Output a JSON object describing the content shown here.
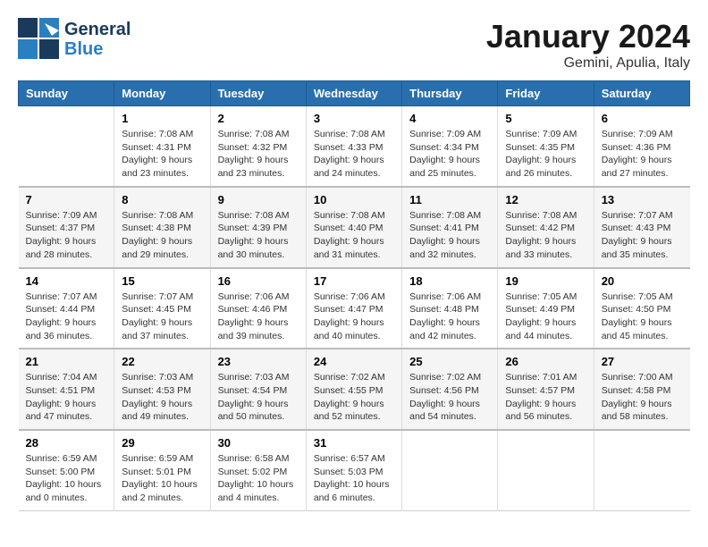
{
  "logo": {
    "line1": "General",
    "line2": "Blue"
  },
  "title": "January 2024",
  "location": "Gemini, Apulia, Italy",
  "headers": [
    "Sunday",
    "Monday",
    "Tuesday",
    "Wednesday",
    "Thursday",
    "Friday",
    "Saturday"
  ],
  "weeks": [
    [
      {
        "day": "",
        "info": ""
      },
      {
        "day": "1",
        "info": "Sunrise: 7:08 AM\nSunset: 4:31 PM\nDaylight: 9 hours\nand 23 minutes."
      },
      {
        "day": "2",
        "info": "Sunrise: 7:08 AM\nSunset: 4:32 PM\nDaylight: 9 hours\nand 23 minutes."
      },
      {
        "day": "3",
        "info": "Sunrise: 7:08 AM\nSunset: 4:33 PM\nDaylight: 9 hours\nand 24 minutes."
      },
      {
        "day": "4",
        "info": "Sunrise: 7:09 AM\nSunset: 4:34 PM\nDaylight: 9 hours\nand 25 minutes."
      },
      {
        "day": "5",
        "info": "Sunrise: 7:09 AM\nSunset: 4:35 PM\nDaylight: 9 hours\nand 26 minutes."
      },
      {
        "day": "6",
        "info": "Sunrise: 7:09 AM\nSunset: 4:36 PM\nDaylight: 9 hours\nand 27 minutes."
      }
    ],
    [
      {
        "day": "7",
        "info": "Sunrise: 7:09 AM\nSunset: 4:37 PM\nDaylight: 9 hours\nand 28 minutes."
      },
      {
        "day": "8",
        "info": "Sunrise: 7:08 AM\nSunset: 4:38 PM\nDaylight: 9 hours\nand 29 minutes."
      },
      {
        "day": "9",
        "info": "Sunrise: 7:08 AM\nSunset: 4:39 PM\nDaylight: 9 hours\nand 30 minutes."
      },
      {
        "day": "10",
        "info": "Sunrise: 7:08 AM\nSunset: 4:40 PM\nDaylight: 9 hours\nand 31 minutes."
      },
      {
        "day": "11",
        "info": "Sunrise: 7:08 AM\nSunset: 4:41 PM\nDaylight: 9 hours\nand 32 minutes."
      },
      {
        "day": "12",
        "info": "Sunrise: 7:08 AM\nSunset: 4:42 PM\nDaylight: 9 hours\nand 33 minutes."
      },
      {
        "day": "13",
        "info": "Sunrise: 7:07 AM\nSunset: 4:43 PM\nDaylight: 9 hours\nand 35 minutes."
      }
    ],
    [
      {
        "day": "14",
        "info": "Sunrise: 7:07 AM\nSunset: 4:44 PM\nDaylight: 9 hours\nand 36 minutes."
      },
      {
        "day": "15",
        "info": "Sunrise: 7:07 AM\nSunset: 4:45 PM\nDaylight: 9 hours\nand 37 minutes."
      },
      {
        "day": "16",
        "info": "Sunrise: 7:06 AM\nSunset: 4:46 PM\nDaylight: 9 hours\nand 39 minutes."
      },
      {
        "day": "17",
        "info": "Sunrise: 7:06 AM\nSunset: 4:47 PM\nDaylight: 9 hours\nand 40 minutes."
      },
      {
        "day": "18",
        "info": "Sunrise: 7:06 AM\nSunset: 4:48 PM\nDaylight: 9 hours\nand 42 minutes."
      },
      {
        "day": "19",
        "info": "Sunrise: 7:05 AM\nSunset: 4:49 PM\nDaylight: 9 hours\nand 44 minutes."
      },
      {
        "day": "20",
        "info": "Sunrise: 7:05 AM\nSunset: 4:50 PM\nDaylight: 9 hours\nand 45 minutes."
      }
    ],
    [
      {
        "day": "21",
        "info": "Sunrise: 7:04 AM\nSunset: 4:51 PM\nDaylight: 9 hours\nand 47 minutes."
      },
      {
        "day": "22",
        "info": "Sunrise: 7:03 AM\nSunset: 4:53 PM\nDaylight: 9 hours\nand 49 minutes."
      },
      {
        "day": "23",
        "info": "Sunrise: 7:03 AM\nSunset: 4:54 PM\nDaylight: 9 hours\nand 50 minutes."
      },
      {
        "day": "24",
        "info": "Sunrise: 7:02 AM\nSunset: 4:55 PM\nDaylight: 9 hours\nand 52 minutes."
      },
      {
        "day": "25",
        "info": "Sunrise: 7:02 AM\nSunset: 4:56 PM\nDaylight: 9 hours\nand 54 minutes."
      },
      {
        "day": "26",
        "info": "Sunrise: 7:01 AM\nSunset: 4:57 PM\nDaylight: 9 hours\nand 56 minutes."
      },
      {
        "day": "27",
        "info": "Sunrise: 7:00 AM\nSunset: 4:58 PM\nDaylight: 9 hours\nand 58 minutes."
      }
    ],
    [
      {
        "day": "28",
        "info": "Sunrise: 6:59 AM\nSunset: 5:00 PM\nDaylight: 10 hours\nand 0 minutes."
      },
      {
        "day": "29",
        "info": "Sunrise: 6:59 AM\nSunset: 5:01 PM\nDaylight: 10 hours\nand 2 minutes."
      },
      {
        "day": "30",
        "info": "Sunrise: 6:58 AM\nSunset: 5:02 PM\nDaylight: 10 hours\nand 4 minutes."
      },
      {
        "day": "31",
        "info": "Sunrise: 6:57 AM\nSunset: 5:03 PM\nDaylight: 10 hours\nand 6 minutes."
      },
      {
        "day": "",
        "info": ""
      },
      {
        "day": "",
        "info": ""
      },
      {
        "day": "",
        "info": ""
      }
    ]
  ]
}
